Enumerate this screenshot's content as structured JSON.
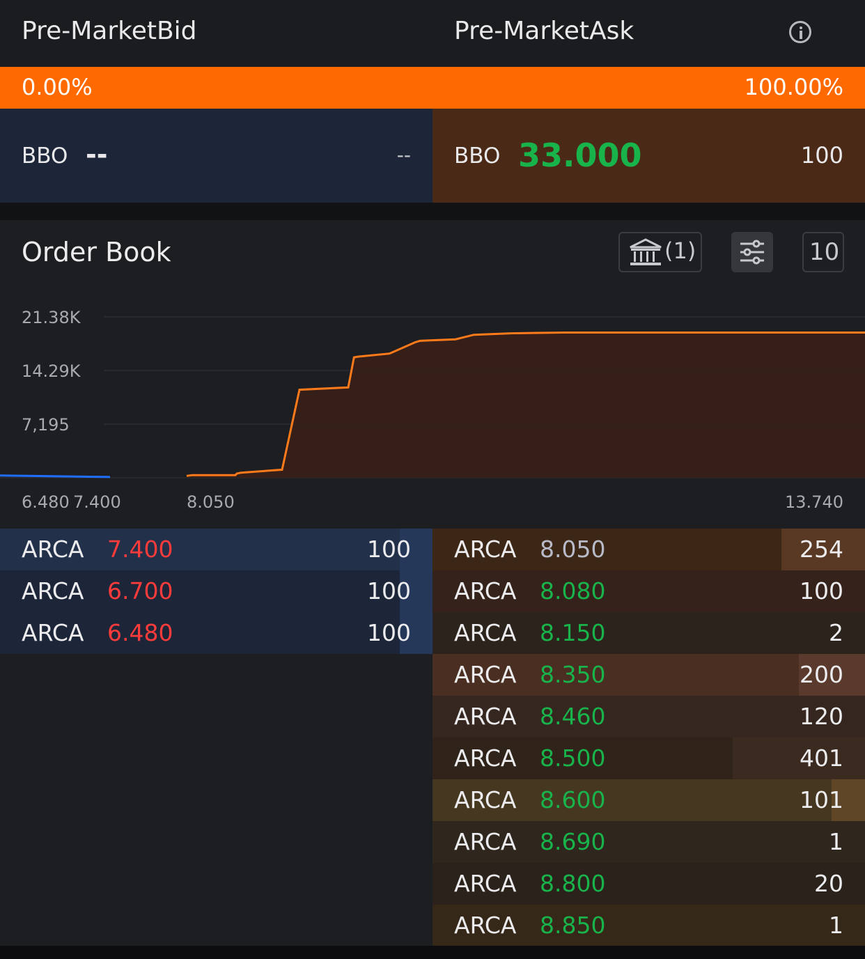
{
  "header": {
    "bid_title": "Pre-MarketBid",
    "ask_title": "Pre-MarketAsk",
    "info_icon": "info-icon"
  },
  "ratio": {
    "bid_pct": "0.00%",
    "ask_pct": "100.00%",
    "bar_color": "#ff6a00"
  },
  "bbo": {
    "bid": {
      "label": "BBO",
      "price": "--",
      "size": "--"
    },
    "ask": {
      "label": "BBO",
      "price": "33.000",
      "size": "100"
    }
  },
  "order_book": {
    "title": "Order Book",
    "exchange_filter": "(1)",
    "depth": "10"
  },
  "chart_data": {
    "type": "area",
    "y_tick_labels": [
      "21.38K",
      "14.29K",
      "7,195"
    ],
    "y_ticks": [
      21380,
      14290,
      7195
    ],
    "ylim": [
      0,
      21380
    ],
    "x_tick_labels": [
      "6.480",
      "7.400",
      "8.050",
      "13.740"
    ],
    "grid": true,
    "series": [
      {
        "color": "#1f6fff",
        "x": [
          6.48,
          7.4
        ],
        "y": [
          300,
          100
        ]
      },
      {
        "color": "#ff7a1a",
        "x": [
          8.05,
          8.08,
          8.15,
          8.2,
          8.35,
          8.46,
          8.5,
          8.6,
          8.65,
          8.69,
          8.75,
          8.8,
          8.85,
          8.95,
          9.05,
          9.2,
          9.5,
          10.0,
          13.74
        ],
        "y": [
          254,
          354,
          356,
          556,
          676,
          1077,
          11700,
          12000,
          16000,
          16100,
          16500,
          18000,
          18200,
          18300,
          18400,
          19000,
          19200,
          19300,
          19300
        ]
      }
    ]
  },
  "bids": [
    {
      "exchange": "ARCA",
      "price": "7.400",
      "size": "100"
    },
    {
      "exchange": "ARCA",
      "price": "6.700",
      "size": "100"
    },
    {
      "exchange": "ARCA",
      "price": "6.480",
      "size": "100"
    }
  ],
  "asks": [
    {
      "exchange": "ARCA",
      "price": "8.050",
      "size": "254"
    },
    {
      "exchange": "ARCA",
      "price": "8.080",
      "size": "100"
    },
    {
      "exchange": "ARCA",
      "price": "8.150",
      "size": "2"
    },
    {
      "exchange": "ARCA",
      "price": "8.350",
      "size": "200"
    },
    {
      "exchange": "ARCA",
      "price": "8.460",
      "size": "120"
    },
    {
      "exchange": "ARCA",
      "price": "8.500",
      "size": "401"
    },
    {
      "exchange": "ARCA",
      "price": "8.600",
      "size": "101"
    },
    {
      "exchange": "ARCA",
      "price": "8.690",
      "size": "1"
    },
    {
      "exchange": "ARCA",
      "price": "8.800",
      "size": "20"
    },
    {
      "exchange": "ARCA",
      "price": "8.850",
      "size": "1"
    }
  ],
  "colors": {
    "bid_price": "#ff3b3b",
    "ask_price": "#18b34a",
    "ask_price_first": "#b8bac8",
    "bid_bg": "#1c2638",
    "ask_bg": "#4a2a17",
    "bid_line": "#1f6fff",
    "ask_line": "#ff7a1a"
  }
}
